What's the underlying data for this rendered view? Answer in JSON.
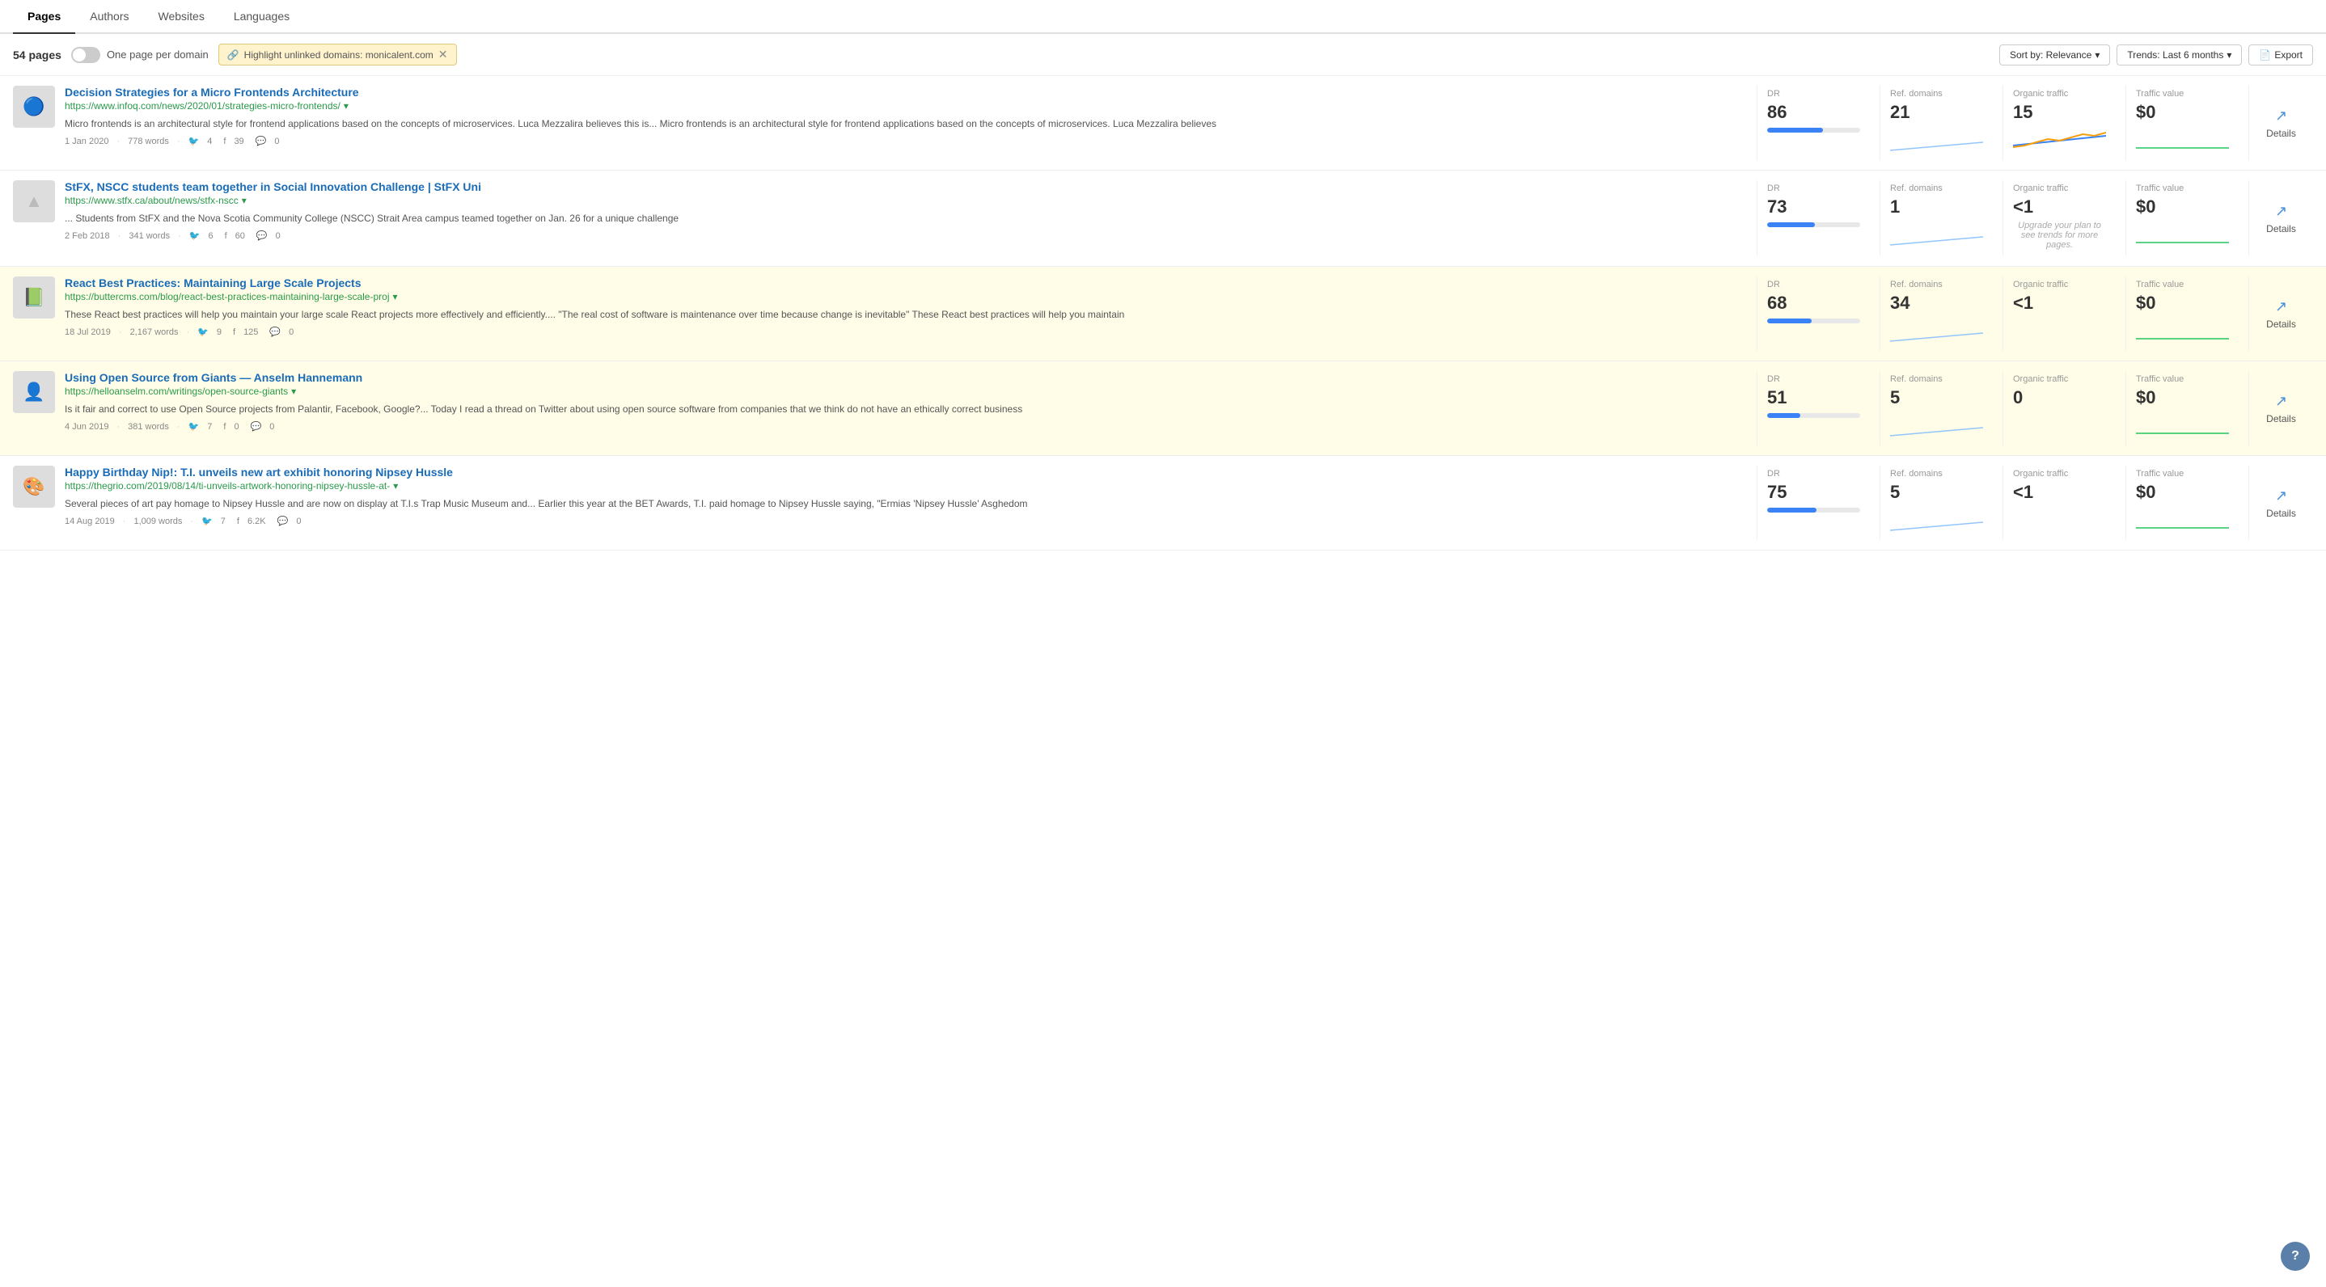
{
  "tabs": [
    {
      "label": "Pages",
      "active": true
    },
    {
      "label": "Authors",
      "active": false
    },
    {
      "label": "Websites",
      "active": false
    },
    {
      "label": "Languages",
      "active": false
    }
  ],
  "toolbar": {
    "page_count": "54 pages",
    "toggle_label": "One page per domain",
    "highlight_label": "Highlight unlinked domains: monicalent.com",
    "sort_label": "Sort by: Relevance",
    "trends_label": "Trends: Last 6 months",
    "export_label": "Export"
  },
  "results": [
    {
      "id": 1,
      "highlighted": false,
      "thumb_type": "image",
      "thumb_text": "🔵",
      "title": "Decision Strategies for a Micro Frontends Architecture",
      "url": "https://www.infoq.com/news/2020/01/strategies-micro-frontends/",
      "snippet": "Micro frontends is an architectural style for frontend applications based on the concepts of microservices. Luca Mezzalira believes this is... Micro frontends is an architectural style for frontend applications based on the concepts of microservices. Luca Mezzalira believes",
      "date": "1 Jan 2020",
      "words": "778 words",
      "twitter": "4",
      "facebook": "39",
      "comments": "0",
      "dr": "86",
      "dr_bar": 86,
      "ref_domains": "21",
      "organic_traffic": "15",
      "traffic_value": "$0",
      "has_chart": true,
      "chart_type": "orange_wave",
      "upgrade_msg": ""
    },
    {
      "id": 2,
      "highlighted": false,
      "thumb_type": "placeholder",
      "thumb_text": "▲",
      "title": "StFX, NSCC students team together in Social Innovation Challenge | StFX Uni",
      "url": "https://www.stfx.ca/about/news/stfx-nscc",
      "snippet": "... Students from StFX and the Nova Scotia Community College (NSCC) Strait Area campus teamed together on Jan. 26 for a unique challenge",
      "date": "2 Feb 2018",
      "words": "341 words",
      "twitter": "6",
      "facebook": "60",
      "comments": "0",
      "dr": "73",
      "dr_bar": 73,
      "ref_domains": "1",
      "organic_traffic": "<1",
      "traffic_value": "$0",
      "has_chart": false,
      "chart_type": "none",
      "upgrade_msg": "Upgrade your plan to see trends for more pages."
    },
    {
      "id": 3,
      "highlighted": true,
      "thumb_type": "image",
      "thumb_text": "📗",
      "title": "React Best Practices: Maintaining Large Scale Projects",
      "url": "https://buttercms.com/blog/react-best-practices-maintaining-large-scale-proj",
      "snippet": "These React best practices will help you maintain your large scale React projects more effectively and efficiently.... \"The real cost of software is maintenance over time because change is inevitable\" These React best practices will help you maintain",
      "date": "18 Jul 2019",
      "words": "2,167 words",
      "twitter": "9",
      "facebook": "125",
      "comments": "0",
      "dr": "68",
      "dr_bar": 68,
      "ref_domains": "34",
      "organic_traffic": "<1",
      "traffic_value": "$0",
      "has_chart": false,
      "chart_type": "none",
      "upgrade_msg": ""
    },
    {
      "id": 4,
      "highlighted": true,
      "thumb_type": "image",
      "thumb_text": "👤",
      "title": "Using Open Source from Giants — Anselm Hannemann",
      "url": "https://helloanselm.com/writings/open-source-giants",
      "snippet": "Is it fair and correct to use Open Source projects from Palantir, Facebook, Google?... Today I read a thread on Twitter about using open source software from companies that we think do not have an ethically correct business",
      "date": "4 Jun 2019",
      "words": "381 words",
      "twitter": "7",
      "facebook": "0",
      "comments": "0",
      "dr": "51",
      "dr_bar": 51,
      "ref_domains": "5",
      "organic_traffic": "0",
      "traffic_value": "$0",
      "has_chart": false,
      "chart_type": "none",
      "upgrade_msg": ""
    },
    {
      "id": 5,
      "highlighted": false,
      "thumb_type": "image",
      "thumb_text": "🎨",
      "title": "Happy Birthday Nip!: T.I. unveils new art exhibit honoring Nipsey Hussle",
      "url": "https://thegrio.com/2019/08/14/ti-unveils-artwork-honoring-nipsey-hussle-at-",
      "snippet": "Several pieces of art pay homage to Nipsey Hussle and are now on display at T.I.s Trap Music Museum and... Earlier this year at the BET Awards, T.I. paid homage to Nipsey Hussle saying, \"Ermias 'Nipsey Hussle' Asghedom",
      "date": "14 Aug 2019",
      "words": "1,009 words",
      "twitter": "7",
      "facebook": "6.2K",
      "comments": "0",
      "dr": "75",
      "dr_bar": 75,
      "ref_domains": "5",
      "organic_traffic": "<1",
      "traffic_value": "$0",
      "has_chart": false,
      "chart_type": "none",
      "upgrade_msg": ""
    }
  ],
  "help_btn": "?",
  "icons": {
    "chevron_down": "▾",
    "link": "🔗",
    "trend_up": "↗",
    "export": "📄",
    "details": "↗"
  }
}
